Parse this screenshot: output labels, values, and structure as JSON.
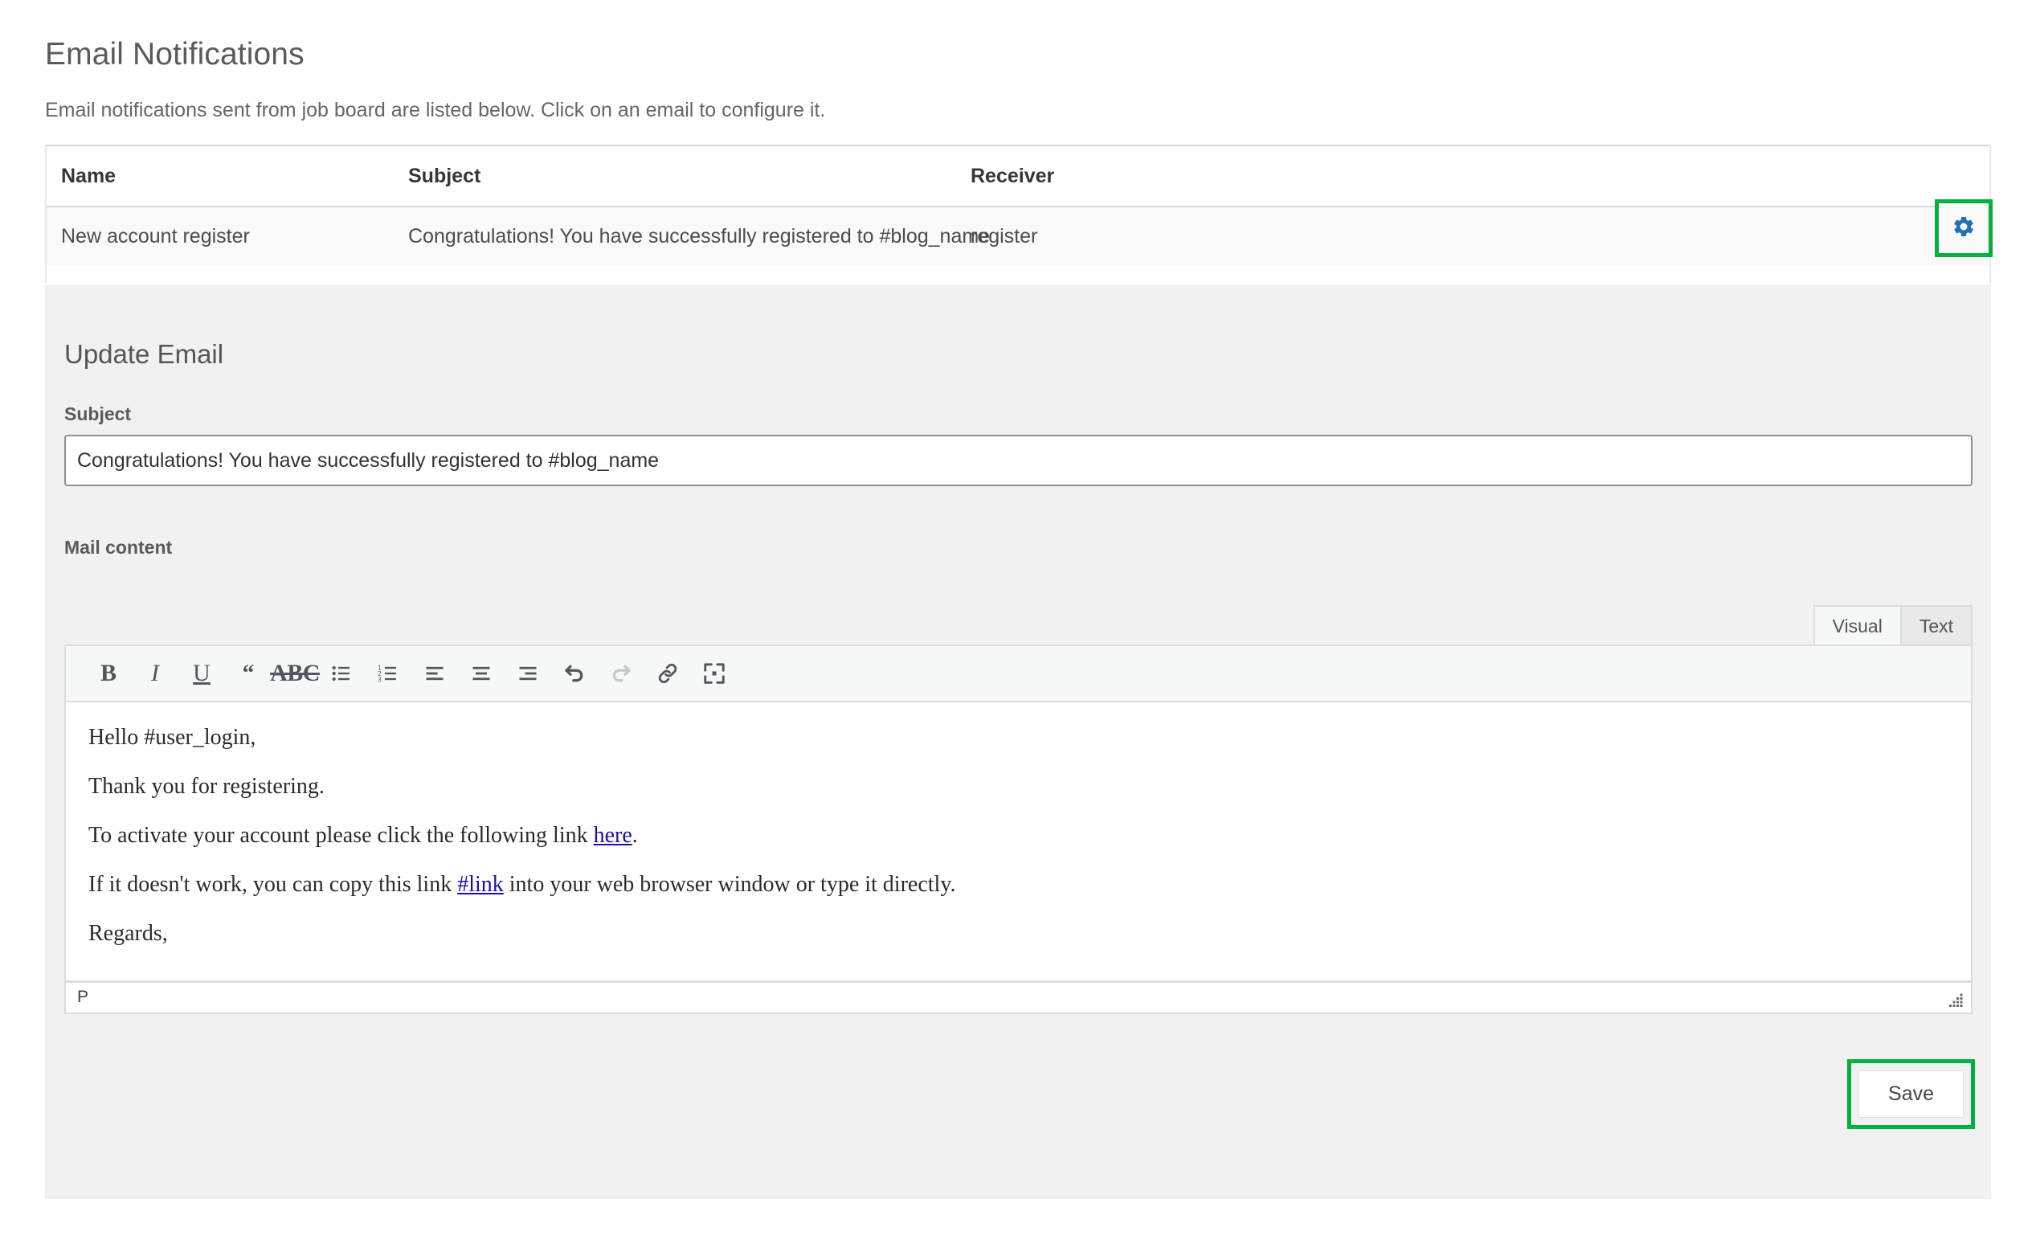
{
  "header": {
    "title": "Email Notifications",
    "description": "Email notifications sent from job board are listed below. Click on an email to configure it."
  },
  "table": {
    "columns": [
      "Name",
      "Subject",
      "Receiver"
    ],
    "rows": [
      {
        "name": "New account register",
        "subject": "Congratulations! You have successfully registered to #blog_name",
        "receiver": "register",
        "action_icon": "gear-icon"
      }
    ]
  },
  "panel": {
    "title": "Update Email",
    "subject_label": "Subject",
    "subject_value": "Congratulations! You have successfully registered to #blog_name",
    "mail_content_label": "Mail content",
    "tabs": [
      {
        "label": "Visual",
        "active": true
      },
      {
        "label": "Text",
        "active": false
      }
    ],
    "toolbar": [
      {
        "name": "bold-icon",
        "glyph": "B"
      },
      {
        "name": "italic-icon",
        "glyph": "I"
      },
      {
        "name": "underline-icon",
        "glyph": "U"
      },
      {
        "name": "blockquote-icon",
        "glyph": "“"
      },
      {
        "name": "strikethrough-icon",
        "glyph": "ABC"
      },
      {
        "name": "bulleted-list-icon",
        "glyph": ""
      },
      {
        "name": "numbered-list-icon",
        "glyph": ""
      },
      {
        "name": "align-left-icon",
        "glyph": ""
      },
      {
        "name": "align-center-icon",
        "glyph": ""
      },
      {
        "name": "align-right-icon",
        "glyph": ""
      },
      {
        "name": "undo-icon",
        "glyph": ""
      },
      {
        "name": "redo-icon",
        "glyph": ""
      },
      {
        "name": "link-icon",
        "glyph": ""
      },
      {
        "name": "fullscreen-icon",
        "glyph": ""
      }
    ],
    "body": {
      "line1": "Hello #user_login,",
      "line2": "Thank you for registering.",
      "line3_pre": "To activate your account please click the following link ",
      "line3_link": "here",
      "line3_post": ".",
      "line4_pre": "If it doesn't work, you can copy this link ",
      "line4_link": "#link",
      "line4_post": " into your web browser window or type it directly.",
      "line5": "Regards,"
    },
    "status_path": "P",
    "save_label": "Save"
  },
  "colors": {
    "accent_gear": "#2271b1",
    "highlight": "#00b140",
    "panel_bg": "#f1f1f1",
    "link": "#1a0dab"
  }
}
